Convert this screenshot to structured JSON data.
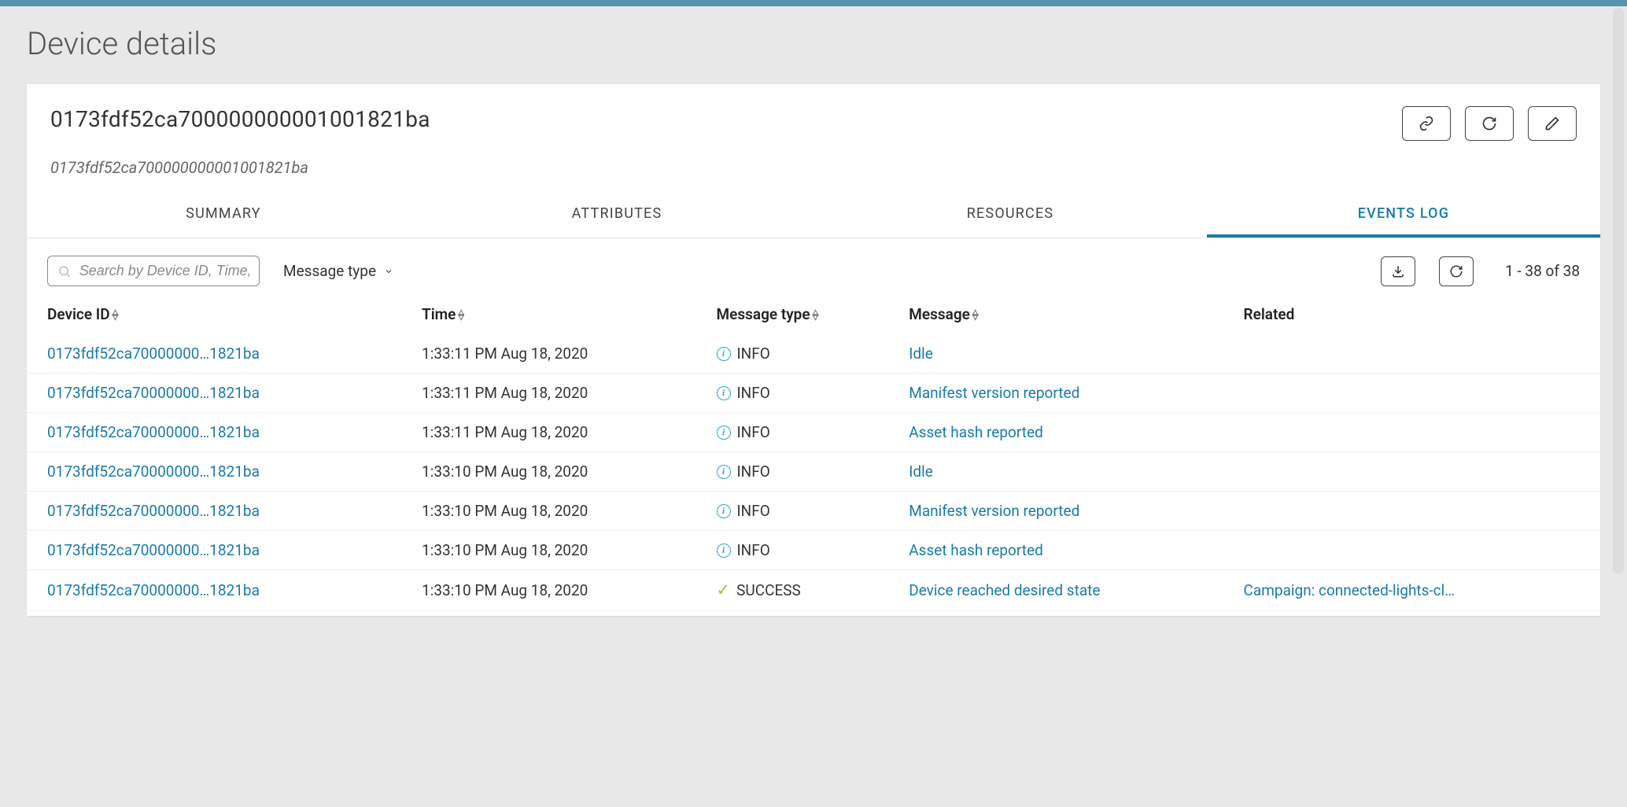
{
  "page_title": "Device details",
  "device_id": "0173fdf52ca700000000001001821ba",
  "device_id_sub": "0173fdf52ca700000000001001821ba",
  "tabs": [
    {
      "label": "SUMMARY",
      "active": false
    },
    {
      "label": "ATTRIBUTES",
      "active": false
    },
    {
      "label": "RESOURCES",
      "active": false
    },
    {
      "label": "EVENTS LOG",
      "active": true
    }
  ],
  "search_placeholder": "Search by Device ID, Time, M",
  "filter_label": "Message type",
  "pagination": "1 - 38 of 38",
  "columns": {
    "device_id": "Device ID",
    "time": "Time",
    "message_type": "Message type",
    "message": "Message",
    "related": "Related"
  },
  "rows": [
    {
      "device_id": "0173fdf52ca70000000…1821ba",
      "time": "1:33:11 PM Aug 18, 2020",
      "type_icon": "info",
      "type_label": "INFO",
      "message": "Idle",
      "related": ""
    },
    {
      "device_id": "0173fdf52ca70000000…1821ba",
      "time": "1:33:11 PM Aug 18, 2020",
      "type_icon": "info",
      "type_label": "INFO",
      "message": "Manifest version reported",
      "related": ""
    },
    {
      "device_id": "0173fdf52ca70000000…1821ba",
      "time": "1:33:11 PM Aug 18, 2020",
      "type_icon": "info",
      "type_label": "INFO",
      "message": "Asset hash reported",
      "related": ""
    },
    {
      "device_id": "0173fdf52ca70000000…1821ba",
      "time": "1:33:10 PM Aug 18, 2020",
      "type_icon": "info",
      "type_label": "INFO",
      "message": "Idle",
      "related": ""
    },
    {
      "device_id": "0173fdf52ca70000000…1821ba",
      "time": "1:33:10 PM Aug 18, 2020",
      "type_icon": "info",
      "type_label": "INFO",
      "message": "Manifest version reported",
      "related": ""
    },
    {
      "device_id": "0173fdf52ca70000000…1821ba",
      "time": "1:33:10 PM Aug 18, 2020",
      "type_icon": "info",
      "type_label": "INFO",
      "message": "Asset hash reported",
      "related": ""
    },
    {
      "device_id": "0173fdf52ca70000000…1821ba",
      "time": "1:33:10 PM Aug 18, 2020",
      "type_icon": "success",
      "type_label": "SUCCESS",
      "message": "Device reached desired state",
      "related": "Campaign: connected-lights-cl…"
    }
  ]
}
